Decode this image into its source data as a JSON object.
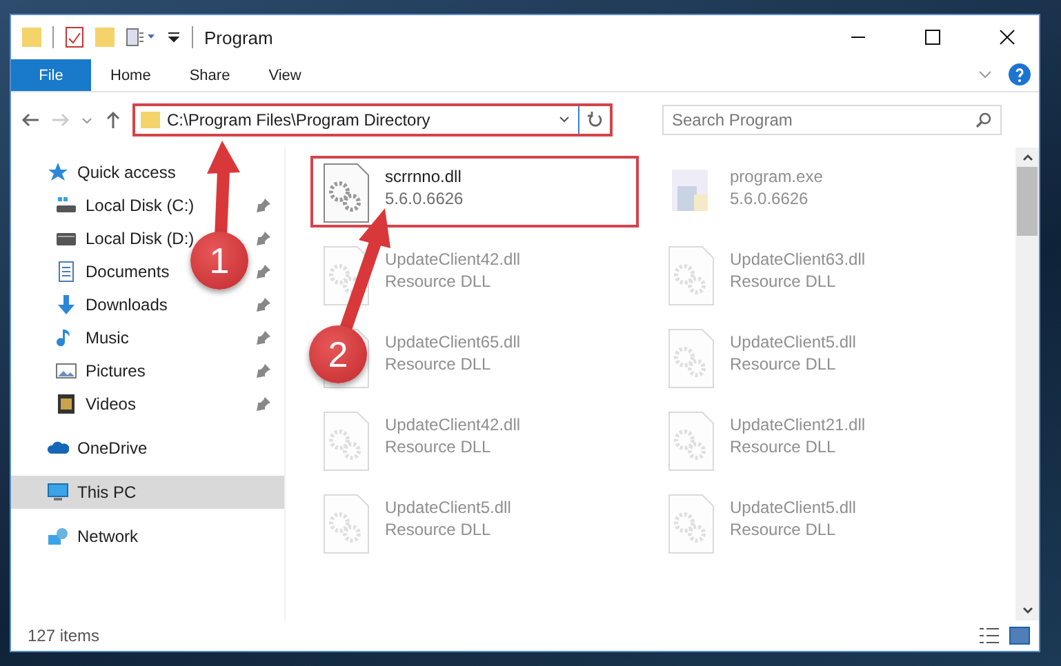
{
  "window": {
    "title": "Program"
  },
  "ribbon_tabs": [
    {
      "label": "File",
      "selected": true
    },
    {
      "label": "Home",
      "selected": false
    },
    {
      "label": "Share",
      "selected": false
    },
    {
      "label": "View",
      "selected": false
    }
  ],
  "address": {
    "value": "C:\\Program Files\\Program Directory",
    "highlighted": true
  },
  "search": {
    "placeholder": "Search Program"
  },
  "sidebar": {
    "items": [
      {
        "label": "Quick access",
        "selected": false,
        "children": [
          {
            "label": "Local Disk (C:)",
            "pinned": true
          },
          {
            "label": "Local Disk (D:)",
            "pinned": true
          },
          {
            "label": "Documents",
            "pinned": true
          },
          {
            "label": "Downloads",
            "pinned": true
          },
          {
            "label": "Music",
            "pinned": true
          },
          {
            "label": "Pictures",
            "pinned": true
          },
          {
            "label": "Videos",
            "pinned": true
          }
        ]
      },
      {
        "label": "OneDrive",
        "selected": false
      },
      {
        "label": "This PC",
        "selected": true
      },
      {
        "label": "Network",
        "selected": false
      }
    ]
  },
  "files": [
    {
      "name": "scrrnno.dll",
      "detail": "5.6.0.6626",
      "kind": "dll",
      "highlighted": true,
      "dimmed": false
    },
    {
      "name": "program.exe",
      "detail": "5.6.0.6626",
      "kind": "exe",
      "highlighted": false,
      "dimmed": true
    },
    {
      "name": "UpdateClient42.dll",
      "detail": "Resource DLL",
      "kind": "dll",
      "highlighted": false,
      "dimmed": true
    },
    {
      "name": "UpdateClient63.dll",
      "detail": "Resource DLL",
      "kind": "dll",
      "highlighted": false,
      "dimmed": true
    },
    {
      "name": "UpdateClient65.dll",
      "detail": "Resource DLL",
      "kind": "dll",
      "highlighted": false,
      "dimmed": true
    },
    {
      "name": "UpdateClient5.dll",
      "detail": "Resource DLL",
      "kind": "dll",
      "highlighted": false,
      "dimmed": true
    },
    {
      "name": "UpdateClient42.dll",
      "detail": "Resource DLL",
      "kind": "dll",
      "highlighted": false,
      "dimmed": true
    },
    {
      "name": "UpdateClient21.dll",
      "detail": "Resource DLL",
      "kind": "dll",
      "highlighted": false,
      "dimmed": true
    },
    {
      "name": "UpdateClient5.dll",
      "detail": "Resource DLL",
      "kind": "dll",
      "highlighted": false,
      "dimmed": true
    },
    {
      "name": "UpdateClient5.dll",
      "detail": "Resource DLL",
      "kind": "dll",
      "highlighted": false,
      "dimmed": true
    }
  ],
  "status_bar": {
    "count": "127 items"
  },
  "annotations": [
    {
      "label": "1"
    },
    {
      "label": "2"
    }
  ]
}
